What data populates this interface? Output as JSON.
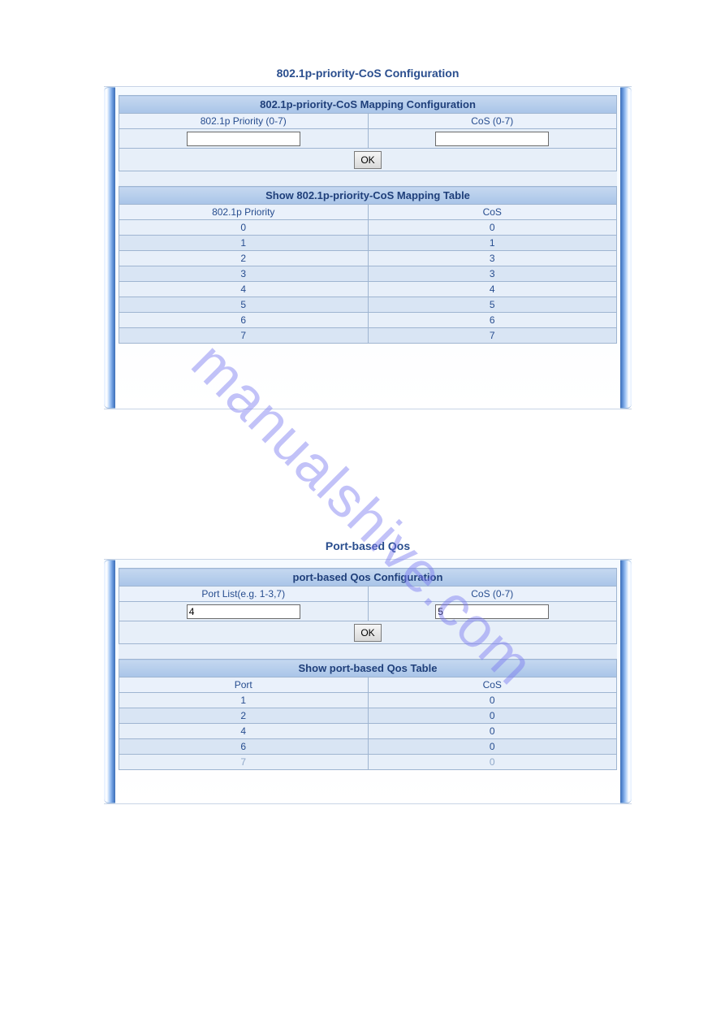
{
  "watermark": "manualshive.com",
  "panel1": {
    "title": "802.1p-priority-CoS Configuration",
    "config": {
      "header": "802.1p-priority-CoS Mapping Configuration",
      "col1": "802.1p Priority (0-7)",
      "col2": "CoS (0-7)",
      "input1": "",
      "input2": "",
      "ok": "OK"
    },
    "table": {
      "header": "Show 802.1p-priority-CoS Mapping Table",
      "col1": "802.1p Priority",
      "col2": "CoS",
      "rows": [
        {
          "p": "0",
          "c": "0"
        },
        {
          "p": "1",
          "c": "1"
        },
        {
          "p": "2",
          "c": "3"
        },
        {
          "p": "3",
          "c": "3"
        },
        {
          "p": "4",
          "c": "4"
        },
        {
          "p": "5",
          "c": "5"
        },
        {
          "p": "6",
          "c": "6"
        },
        {
          "p": "7",
          "c": "7"
        }
      ]
    }
  },
  "panel2": {
    "title": "Port-based Qos",
    "config": {
      "header": "port-based Qos Configuration",
      "col1": "Port List(e.g. 1-3,7)",
      "col2": "CoS (0-7)",
      "input1": "4",
      "input2": "5",
      "ok": "OK"
    },
    "table": {
      "header": "Show port-based Qos Table",
      "col1": "Port",
      "col2": "CoS",
      "rows": [
        {
          "p": "1",
          "c": "0"
        },
        {
          "p": "2",
          "c": "0"
        },
        {
          "p": "4",
          "c": "0"
        },
        {
          "p": "6",
          "c": "0"
        },
        {
          "p": "7",
          "c": "0"
        }
      ]
    }
  }
}
